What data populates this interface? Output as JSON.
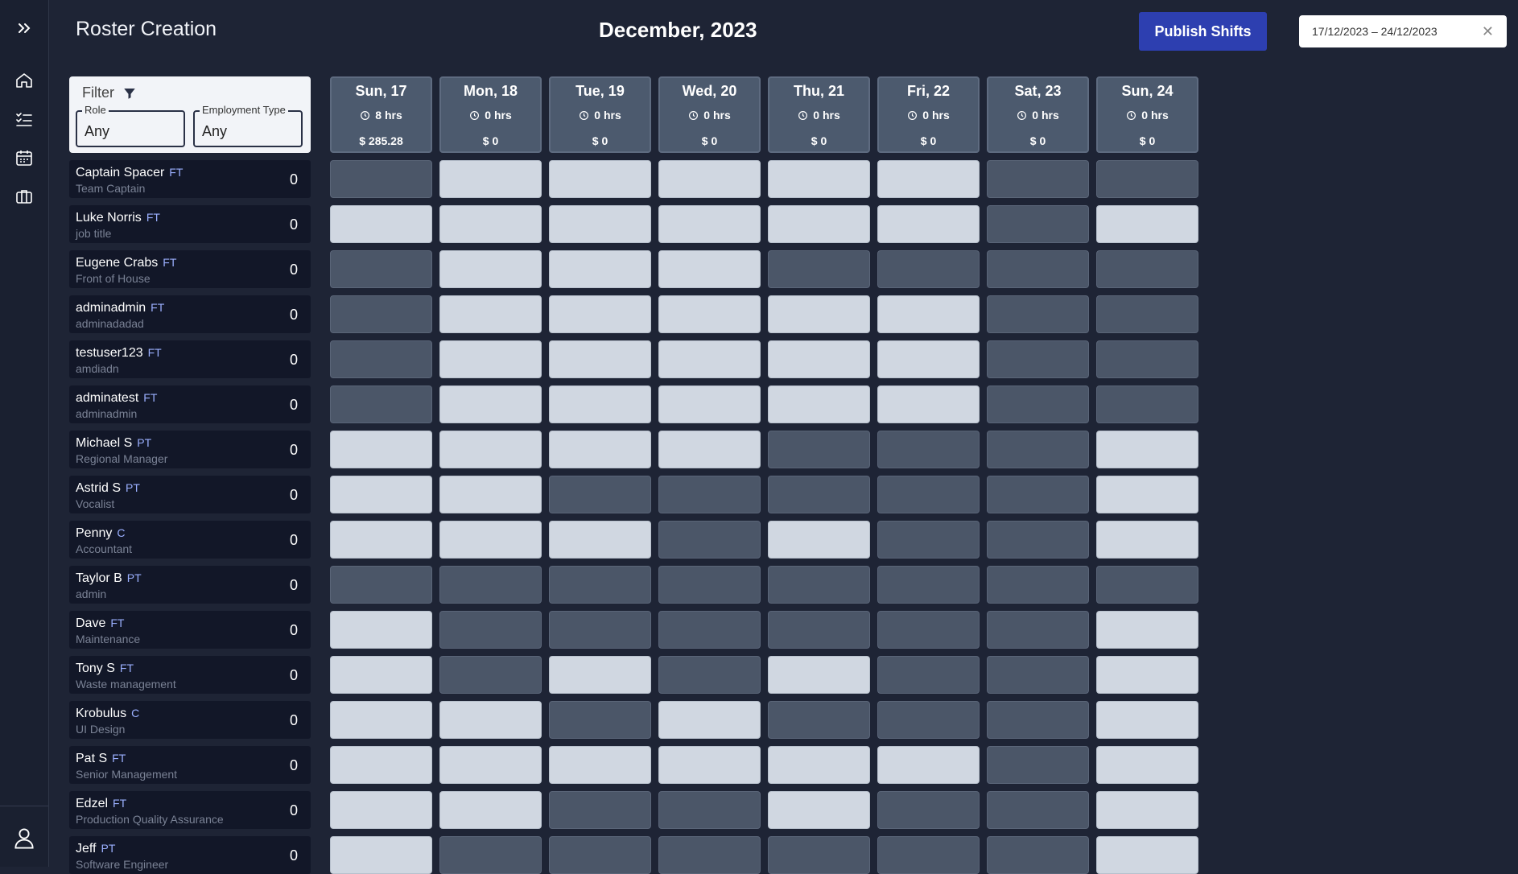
{
  "app": {
    "title": "Roster Creation",
    "month": "December, 2023"
  },
  "sidebar": {
    "items": [
      {
        "icon": "double-chevron-right-icon"
      },
      {
        "icon": "home-icon"
      },
      {
        "icon": "checklist-icon"
      },
      {
        "icon": "calendar-icon"
      },
      {
        "icon": "briefcase-icon"
      },
      {
        "icon": "user-icon"
      }
    ]
  },
  "toolbar": {
    "publish_label": "Publish Shifts",
    "date_range": "17/12/2023 – 24/12/2023"
  },
  "filter": {
    "label": "Filter",
    "role": {
      "label": "Role",
      "value": "Any"
    },
    "employment_type": {
      "label": "Employment Type",
      "value": "Any"
    }
  },
  "days": [
    {
      "name": "Sun, 17",
      "hours": "8 hrs",
      "cost": "$ 285.28"
    },
    {
      "name": "Mon, 18",
      "hours": "0 hrs",
      "cost": "$ 0"
    },
    {
      "name": "Tue, 19",
      "hours": "0 hrs",
      "cost": "$ 0"
    },
    {
      "name": "Wed, 20",
      "hours": "0 hrs",
      "cost": "$ 0"
    },
    {
      "name": "Thu, 21",
      "hours": "0 hrs",
      "cost": "$ 0"
    },
    {
      "name": "Fri, 22",
      "hours": "0 hrs",
      "cost": "$ 0"
    },
    {
      "name": "Sat, 23",
      "hours": "0 hrs",
      "cost": "$ 0"
    },
    {
      "name": "Sun, 24",
      "hours": "0 hrs",
      "cost": "$ 0"
    }
  ],
  "employees": [
    {
      "name": "Captain Spacer",
      "type": "FT",
      "role": "Team Captain",
      "count": "0"
    },
    {
      "name": "Luke Norris",
      "type": "FT",
      "role": "job title",
      "count": "0"
    },
    {
      "name": "Eugene Crabs",
      "type": "FT",
      "role": "Front of House",
      "count": "0"
    },
    {
      "name": "adminadmin",
      "type": "FT",
      "role": "adminadadad",
      "count": "0"
    },
    {
      "name": "testuser123",
      "type": "FT",
      "role": "amdiadn",
      "count": "0"
    },
    {
      "name": "adminatest",
      "type": "FT",
      "role": "adminadmin",
      "count": "0"
    },
    {
      "name": "Michael S",
      "type": "PT",
      "role": "Regional Manager",
      "count": "0"
    },
    {
      "name": "Astrid S",
      "type": "PT",
      "role": "Vocalist",
      "count": "0"
    },
    {
      "name": "Penny",
      "type": "C",
      "role": "Accountant",
      "count": "0"
    },
    {
      "name": "Taylor B",
      "type": "PT",
      "role": "admin",
      "count": "0"
    },
    {
      "name": "Dave",
      "type": "FT",
      "role": "Maintenance",
      "count": "0"
    },
    {
      "name": "Tony S",
      "type": "FT",
      "role": "Waste management",
      "count": "0"
    },
    {
      "name": "Krobulus",
      "type": "C",
      "role": "UI Design",
      "count": "0"
    },
    {
      "name": "Pat S",
      "type": "FT",
      "role": "Senior Management",
      "count": "0"
    },
    {
      "name": "Edzel",
      "type": "FT",
      "role": "Production Quality Assurance",
      "count": "0"
    },
    {
      "name": "Jeff",
      "type": "PT",
      "role": "Software Engineer",
      "count": "0"
    }
  ],
  "availability": [
    [
      0,
      1,
      1,
      1,
      1,
      1,
      0,
      0
    ],
    [
      1,
      1,
      1,
      1,
      1,
      1,
      0,
      1
    ],
    [
      0,
      1,
      1,
      1,
      0,
      0,
      0,
      0
    ],
    [
      0,
      1,
      1,
      1,
      1,
      1,
      0,
      0
    ],
    [
      0,
      1,
      1,
      1,
      1,
      1,
      0,
      0
    ],
    [
      0,
      1,
      1,
      1,
      1,
      1,
      0,
      0
    ],
    [
      1,
      1,
      1,
      1,
      0,
      0,
      0,
      1
    ],
    [
      1,
      1,
      0,
      0,
      0,
      0,
      0,
      1
    ],
    [
      1,
      1,
      1,
      0,
      1,
      0,
      0,
      1
    ],
    [
      0,
      0,
      0,
      0,
      0,
      0,
      0,
      0
    ],
    [
      1,
      0,
      0,
      0,
      0,
      0,
      0,
      1
    ],
    [
      1,
      0,
      1,
      0,
      1,
      0,
      0,
      1
    ],
    [
      1,
      1,
      0,
      1,
      0,
      0,
      0,
      1
    ],
    [
      1,
      1,
      1,
      1,
      1,
      1,
      0,
      1
    ],
    [
      1,
      1,
      0,
      0,
      1,
      0,
      0,
      1
    ],
    [
      1,
      0,
      0,
      0,
      0,
      0,
      0,
      1
    ]
  ],
  "colors": {
    "background": "#1e2435",
    "available_cell": "#d0d7e1",
    "unavailable_cell": "#4b5668",
    "publish_button": "#2d3fb0",
    "type_badge": "#9bb0ff"
  }
}
